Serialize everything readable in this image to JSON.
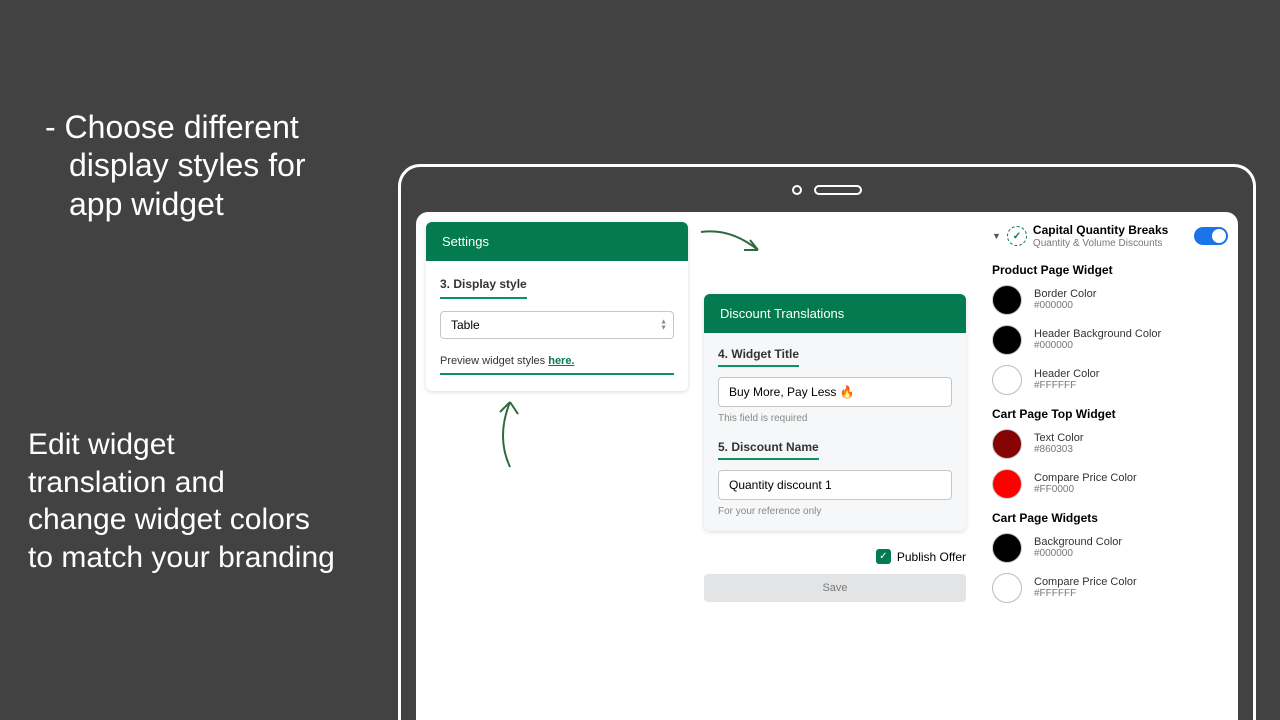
{
  "marketing": {
    "top_line1": "- Choose different",
    "top_line2": "display styles for",
    "top_line3": "app widget",
    "bottom_line1": "Edit widget",
    "bottom_line2": "translation and",
    "bottom_line3": "change widget colors",
    "bottom_line4": "to match your branding"
  },
  "settings": {
    "header": "Settings",
    "display_style_label": "3. Display style",
    "display_style_value": "Table",
    "preview_text": "Preview widget styles ",
    "preview_link": "here."
  },
  "translations": {
    "header": "Discount Translations",
    "widget_title_label": "4. Widget Title",
    "widget_title_value": "Buy More, Pay Less 🔥",
    "widget_title_helper": "This field is required",
    "discount_name_label": "5. Discount Name",
    "discount_name_value": "Quantity discount 1",
    "discount_name_helper": "For your reference only"
  },
  "publish": {
    "label": "Publish Offer",
    "checked": true,
    "save_label": "Save"
  },
  "app": {
    "name": "Capital Quantity Breaks",
    "subtitle": "Quantity & Volume Discounts",
    "enabled": true
  },
  "color_groups": [
    {
      "title": "Product Page Widget",
      "colors": [
        {
          "name": "Border Color",
          "hex": "#000000"
        },
        {
          "name": "Header Background Color",
          "hex": "#000000"
        },
        {
          "name": "Header Color",
          "hex": "#FFFFFF"
        }
      ]
    },
    {
      "title": "Cart Page Top Widget",
      "colors": [
        {
          "name": "Text Color",
          "hex": "#860303"
        },
        {
          "name": "Compare Price Color",
          "hex": "#FF0000"
        }
      ]
    },
    {
      "title": "Cart Page Widgets",
      "colors": [
        {
          "name": "Background Color",
          "hex": "#000000"
        },
        {
          "name": "Compare Price Color",
          "hex": "#FFFFFF"
        }
      ]
    }
  ]
}
